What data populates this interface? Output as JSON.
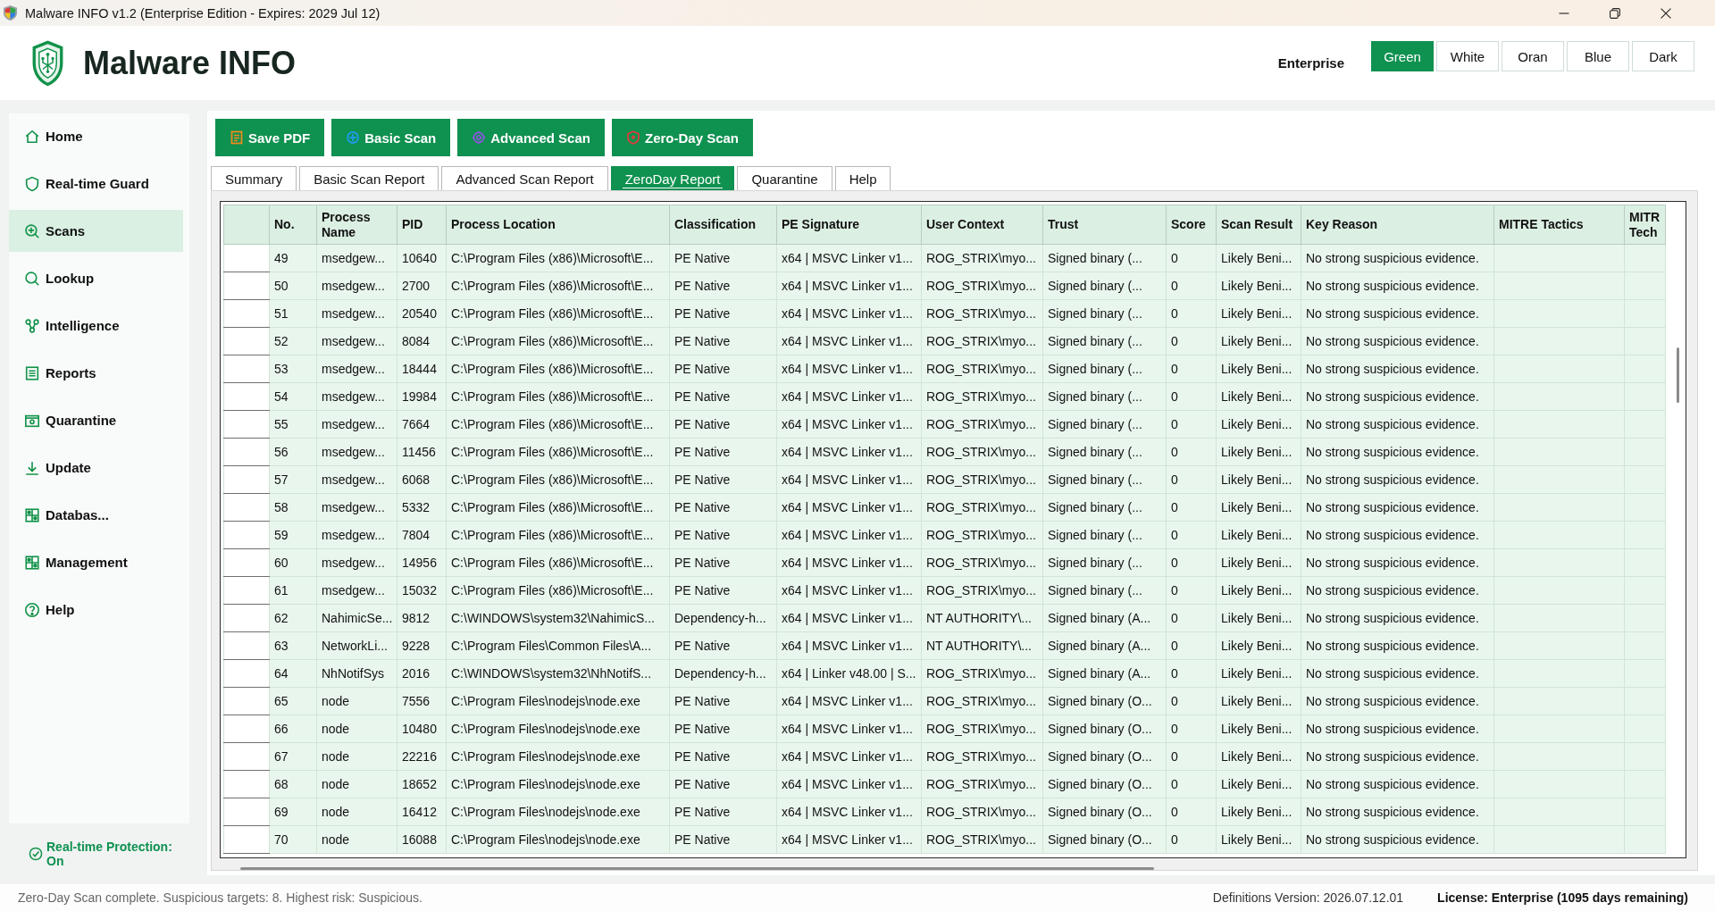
{
  "window": {
    "title": "Malware INFO v1.2 (Enterprise Edition - Expires: 2029 Jul 12)"
  },
  "header": {
    "app_name": "Malware INFO",
    "edition": "Enterprise",
    "themes": [
      {
        "label": "Green",
        "selected": true
      },
      {
        "label": "White",
        "selected": false
      },
      {
        "label": "Oran",
        "selected": false
      },
      {
        "label": "Blue",
        "selected": false
      },
      {
        "label": "Dark",
        "selected": false
      }
    ]
  },
  "sidebar": {
    "items": [
      {
        "label": "Home",
        "selected": false
      },
      {
        "label": "Real-time Guard",
        "selected": false
      },
      {
        "label": "Scans",
        "selected": true
      },
      {
        "label": "Lookup",
        "selected": false
      },
      {
        "label": "Intelligence",
        "selected": false
      },
      {
        "label": "Reports",
        "selected": false
      },
      {
        "label": "Quarantine",
        "selected": false
      },
      {
        "label": "Update",
        "selected": false
      },
      {
        "label": "Databas...",
        "selected": false
      },
      {
        "label": "Management",
        "selected": false
      },
      {
        "label": "Help",
        "selected": false
      }
    ],
    "protection_status": "Real-time Protection: On"
  },
  "toolbar": {
    "buttons": [
      "Save PDF",
      "Basic Scan",
      "Advanced Scan",
      "Zero-Day Scan"
    ]
  },
  "tabs": [
    {
      "label": "Summary",
      "selected": false
    },
    {
      "label": "Basic Scan Report",
      "selected": false
    },
    {
      "label": "Advanced Scan Report",
      "selected": false
    },
    {
      "label": "ZeroDay Report",
      "selected": true
    },
    {
      "label": "Quarantine",
      "selected": false
    },
    {
      "label": "Help",
      "selected": false
    }
  ],
  "table": {
    "columns": [
      "No.",
      "Process Name",
      "PID",
      "Process Location",
      "Classification",
      "PE Signature",
      "User Context",
      "Trust",
      "Score",
      "Scan Result",
      "Key Reason",
      "MITRE Tactics",
      "MITR Tech"
    ],
    "rows": [
      [
        "49",
        "msedgew...",
        "10640",
        "C:\\Program Files (x86)\\Microsoft\\E...",
        "PE Native",
        "x64 | MSVC Linker v1...",
        "ROG_STRIX\\myo...",
        "Signed binary (...",
        "0",
        "Likely Beni...",
        "No strong suspicious evidence."
      ],
      [
        "50",
        "msedgew...",
        "2700",
        "C:\\Program Files (x86)\\Microsoft\\E...",
        "PE Native",
        "x64 | MSVC Linker v1...",
        "ROG_STRIX\\myo...",
        "Signed binary (...",
        "0",
        "Likely Beni...",
        "No strong suspicious evidence."
      ],
      [
        "51",
        "msedgew...",
        "20540",
        "C:\\Program Files (x86)\\Microsoft\\E...",
        "PE Native",
        "x64 | MSVC Linker v1...",
        "ROG_STRIX\\myo...",
        "Signed binary (...",
        "0",
        "Likely Beni...",
        "No strong suspicious evidence."
      ],
      [
        "52",
        "msedgew...",
        "8084",
        "C:\\Program Files (x86)\\Microsoft\\E...",
        "PE Native",
        "x64 | MSVC Linker v1...",
        "ROG_STRIX\\myo...",
        "Signed binary (...",
        "0",
        "Likely Beni...",
        "No strong suspicious evidence."
      ],
      [
        "53",
        "msedgew...",
        "18444",
        "C:\\Program Files (x86)\\Microsoft\\E...",
        "PE Native",
        "x64 | MSVC Linker v1...",
        "ROG_STRIX\\myo...",
        "Signed binary (...",
        "0",
        "Likely Beni...",
        "No strong suspicious evidence."
      ],
      [
        "54",
        "msedgew...",
        "19984",
        "C:\\Program Files (x86)\\Microsoft\\E...",
        "PE Native",
        "x64 | MSVC Linker v1...",
        "ROG_STRIX\\myo...",
        "Signed binary (...",
        "0",
        "Likely Beni...",
        "No strong suspicious evidence."
      ],
      [
        "55",
        "msedgew...",
        "7664",
        "C:\\Program Files (x86)\\Microsoft\\E...",
        "PE Native",
        "x64 | MSVC Linker v1...",
        "ROG_STRIX\\myo...",
        "Signed binary (...",
        "0",
        "Likely Beni...",
        "No strong suspicious evidence."
      ],
      [
        "56",
        "msedgew...",
        "11456",
        "C:\\Program Files (x86)\\Microsoft\\E...",
        "PE Native",
        "x64 | MSVC Linker v1...",
        "ROG_STRIX\\myo...",
        "Signed binary (...",
        "0",
        "Likely Beni...",
        "No strong suspicious evidence."
      ],
      [
        "57",
        "msedgew...",
        "6068",
        "C:\\Program Files (x86)\\Microsoft\\E...",
        "PE Native",
        "x64 | MSVC Linker v1...",
        "ROG_STRIX\\myo...",
        "Signed binary (...",
        "0",
        "Likely Beni...",
        "No strong suspicious evidence."
      ],
      [
        "58",
        "msedgew...",
        "5332",
        "C:\\Program Files (x86)\\Microsoft\\E...",
        "PE Native",
        "x64 | MSVC Linker v1...",
        "ROG_STRIX\\myo...",
        "Signed binary (...",
        "0",
        "Likely Beni...",
        "No strong suspicious evidence."
      ],
      [
        "59",
        "msedgew...",
        "7804",
        "C:\\Program Files (x86)\\Microsoft\\E...",
        "PE Native",
        "x64 | MSVC Linker v1...",
        "ROG_STRIX\\myo...",
        "Signed binary (...",
        "0",
        "Likely Beni...",
        "No strong suspicious evidence."
      ],
      [
        "60",
        "msedgew...",
        "14956",
        "C:\\Program Files (x86)\\Microsoft\\E...",
        "PE Native",
        "x64 | MSVC Linker v1...",
        "ROG_STRIX\\myo...",
        "Signed binary (...",
        "0",
        "Likely Beni...",
        "No strong suspicious evidence."
      ],
      [
        "61",
        "msedgew...",
        "15032",
        "C:\\Program Files (x86)\\Microsoft\\E...",
        "PE Native",
        "x64 | MSVC Linker v1...",
        "ROG_STRIX\\myo...",
        "Signed binary (...",
        "0",
        "Likely Beni...",
        "No strong suspicious evidence."
      ],
      [
        "62",
        "NahimicSe...",
        "9812",
        "C:\\WINDOWS\\system32\\NahimicS...",
        "Dependency-h...",
        "x64 | MSVC Linker v1...",
        "NT AUTHORITY\\...",
        "Signed binary (A...",
        "0",
        "Likely Beni...",
        "No strong suspicious evidence."
      ],
      [
        "63",
        "NetworkLi...",
        "9228",
        "C:\\Program Files\\Common Files\\A...",
        "PE Native",
        "x64 | MSVC Linker v1...",
        "NT AUTHORITY\\...",
        "Signed binary (A...",
        "0",
        "Likely Beni...",
        "No strong suspicious evidence."
      ],
      [
        "64",
        "NhNotifSys",
        "2016",
        "C:\\WINDOWS\\system32\\NhNotifS...",
        "Dependency-h...",
        "x64 | Linker v48.00 | S...",
        "ROG_STRIX\\myo...",
        "Signed binary (A...",
        "0",
        "Likely Beni...",
        "No strong suspicious evidence."
      ],
      [
        "65",
        "node",
        "7556",
        "C:\\Program Files\\nodejs\\node.exe",
        "PE Native",
        "x64 | MSVC Linker v1...",
        "ROG_STRIX\\myo...",
        "Signed binary (O...",
        "0",
        "Likely Beni...",
        "No strong suspicious evidence."
      ],
      [
        "66",
        "node",
        "10480",
        "C:\\Program Files\\nodejs\\node.exe",
        "PE Native",
        "x64 | MSVC Linker v1...",
        "ROG_STRIX\\myo...",
        "Signed binary (O...",
        "0",
        "Likely Beni...",
        "No strong suspicious evidence."
      ],
      [
        "67",
        "node",
        "22216",
        "C:\\Program Files\\nodejs\\node.exe",
        "PE Native",
        "x64 | MSVC Linker v1...",
        "ROG_STRIX\\myo...",
        "Signed binary (O...",
        "0",
        "Likely Beni...",
        "No strong suspicious evidence."
      ],
      [
        "68",
        "node",
        "18652",
        "C:\\Program Files\\nodejs\\node.exe",
        "PE Native",
        "x64 | MSVC Linker v1...",
        "ROG_STRIX\\myo...",
        "Signed binary (O...",
        "0",
        "Likely Beni...",
        "No strong suspicious evidence."
      ],
      [
        "69",
        "node",
        "16412",
        "C:\\Program Files\\nodejs\\node.exe",
        "PE Native",
        "x64 | MSVC Linker v1...",
        "ROG_STRIX\\myo...",
        "Signed binary (O...",
        "0",
        "Likely Beni...",
        "No strong suspicious evidence."
      ],
      [
        "70",
        "node",
        "16088",
        "C:\\Program Files\\nodejs\\node.exe",
        "PE Native",
        "x64 | MSVC Linker v1...",
        "ROG_STRIX\\myo...",
        "Signed binary (O...",
        "0",
        "Likely Beni...",
        "No strong suspicious evidence."
      ]
    ]
  },
  "status_bar": {
    "message": "Zero-Day Scan complete. Suspicious targets: 8. Highest risk: Suspicious.",
    "definitions": "Definitions Version: 2026.07.12.01",
    "license": "License: Enterprise (1095 days remaining)"
  }
}
